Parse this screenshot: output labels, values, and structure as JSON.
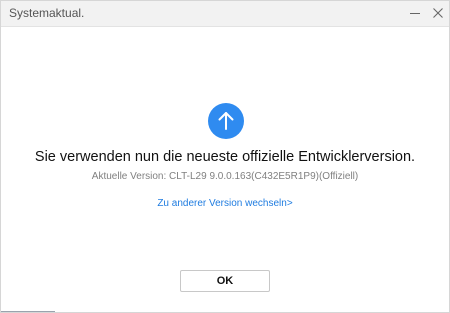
{
  "window": {
    "title": "Systemaktual."
  },
  "icons": {
    "update": "arrow-up-circle-icon",
    "minimize": "minimize-icon",
    "close": "close-icon"
  },
  "colors": {
    "accent": "#2f8bf0",
    "link": "#1f7ce0",
    "secondary_text": "#808080"
  },
  "main": {
    "headline": "Sie verwenden nun die neueste offizielle Entwicklerversion.",
    "current_version": "Aktuelle Version: CLT-L29 9.0.0.163(C432E5R1P9)(Offiziell)",
    "switch_version_link": "Zu anderer Version wechseln>",
    "ok_label": "OK"
  }
}
